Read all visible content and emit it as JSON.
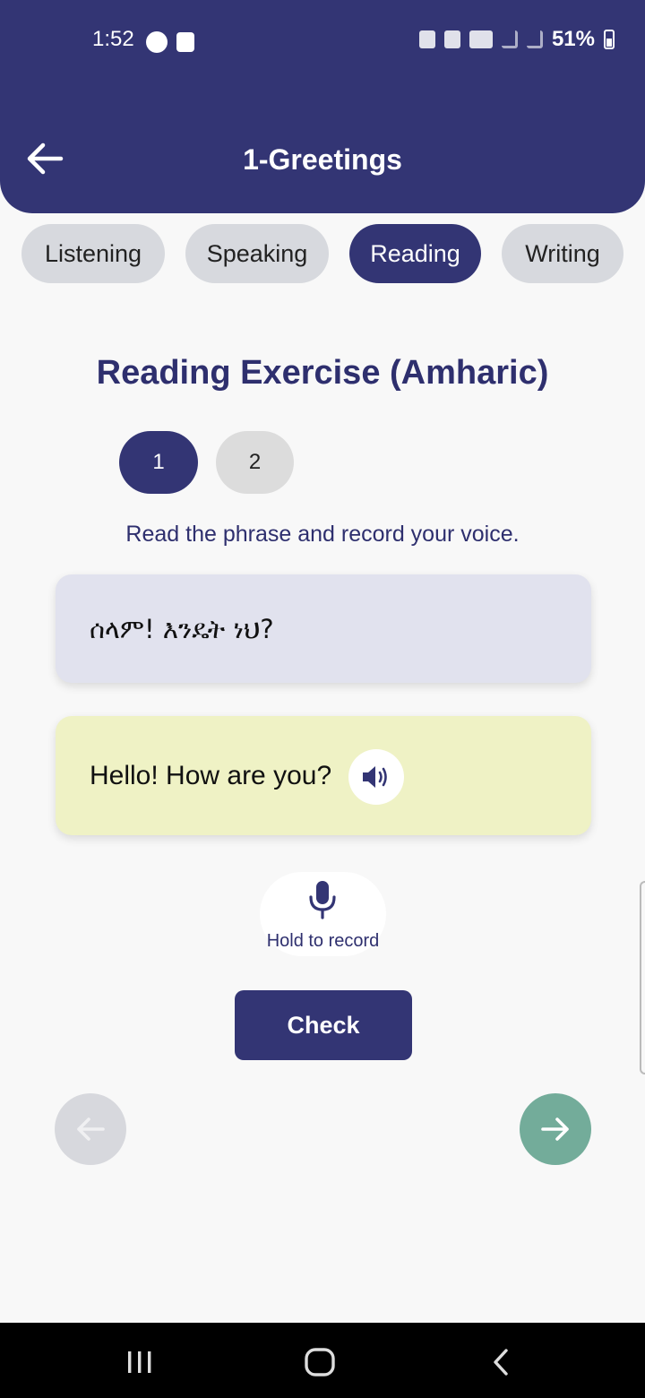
{
  "status_bar": {
    "time": "1:52",
    "battery": "51%"
  },
  "header": {
    "title": "1-Greetings"
  },
  "tabs": [
    {
      "label": "Listening",
      "active": false
    },
    {
      "label": "Speaking",
      "active": false
    },
    {
      "label": "Reading",
      "active": true
    },
    {
      "label": "Writing",
      "active": false
    }
  ],
  "exercise": {
    "title": "Reading Exercise (Amharic)",
    "steps": [
      "1",
      "2"
    ],
    "current_step": "1",
    "instruction": "Read the phrase and record your voice.",
    "amharic_phrase": "ሰላም! እንዴት ነህ?",
    "english_phrase": "Hello! How are you?",
    "record_label": "Hold to record",
    "check_label": "Check"
  },
  "colors": {
    "primary": "#333574",
    "next_button": "#73ac9a",
    "english_card": "#eff2c5",
    "amharic_card": "#e1e2ee"
  }
}
